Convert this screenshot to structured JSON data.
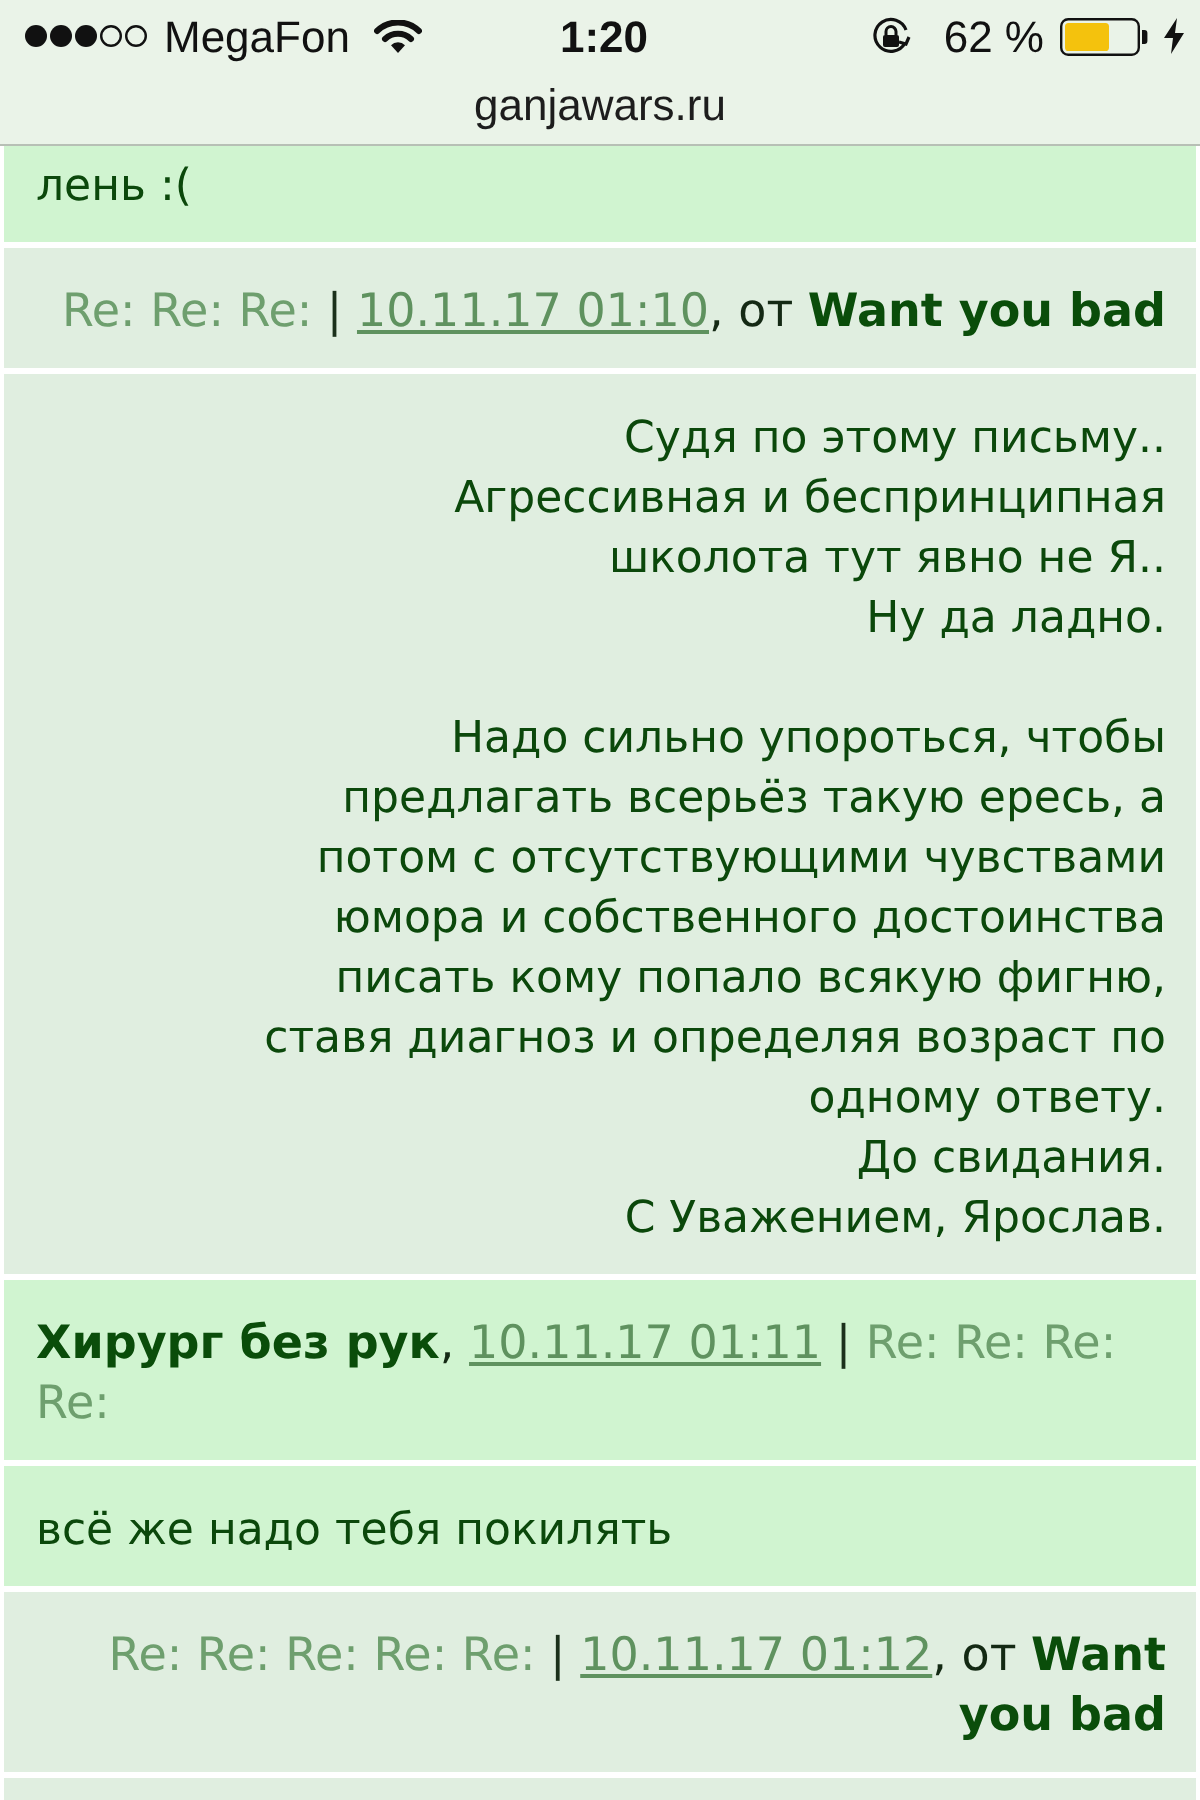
{
  "status_bar": {
    "carrier": "MegaFon",
    "time": "1:20",
    "battery_text": "62 %"
  },
  "address_bar": {
    "url": "ganjawars.ru"
  },
  "messages": [
    {
      "kind": "incoming",
      "body": [
        {
          "lines": [
            "лень :("
          ]
        }
      ]
    },
    {
      "kind": "outgoing",
      "header": [
        {
          "kind": "subject",
          "text": "Re: Re: Re:"
        },
        {
          "kind": "separator",
          "text": "|"
        },
        {
          "kind": "date",
          "text": "10.11.17 01:10"
        },
        {
          "kind": "punct",
          "text": ","
        },
        {
          "kind": "plain",
          "text": "от"
        },
        {
          "kind": "author",
          "text": "Want you bad"
        }
      ],
      "body": [
        {
          "lines": [
            "Судя по этому письму..",
            "Агрессивная и беспринципная",
            "школота тут явно не Я..",
            "Ну да ладно."
          ]
        },
        {
          "lines": [
            "Надо сильно упороться, чтобы",
            "предлагать всерьёз такую ересь, а",
            "потом с отсутствующими чувствами",
            "юмора и собственного достоинства",
            "писать кому попало всякую фигню,",
            "ставя диагноз и определяя возраст по",
            "одному ответу.",
            "До свидания.",
            "С Уважением, Ярослав."
          ]
        }
      ]
    },
    {
      "kind": "incoming",
      "header": [
        {
          "kind": "author",
          "text": "Хирург без рук"
        },
        {
          "kind": "punct",
          "text": ","
        },
        {
          "kind": "date",
          "text": "10.11.17 01:11"
        },
        {
          "kind": "separator",
          "text": "|"
        },
        {
          "kind": "subject",
          "text": "Re: Re: Re: Re:"
        }
      ],
      "body": [
        {
          "lines": [
            "всё же надо тебя покилять"
          ]
        }
      ]
    },
    {
      "kind": "outgoing",
      "header": [
        {
          "kind": "subject",
          "text": "Re: Re: Re: Re: Re:"
        },
        {
          "kind": "separator",
          "text": "|"
        },
        {
          "kind": "date",
          "text": "10.11.17 01:12"
        },
        {
          "kind": "punct",
          "text": ","
        },
        {
          "kind": "plain",
          "text": "от"
        },
        {
          "kind": "author",
          "text": "Want you bad"
        }
      ]
    }
  ]
}
